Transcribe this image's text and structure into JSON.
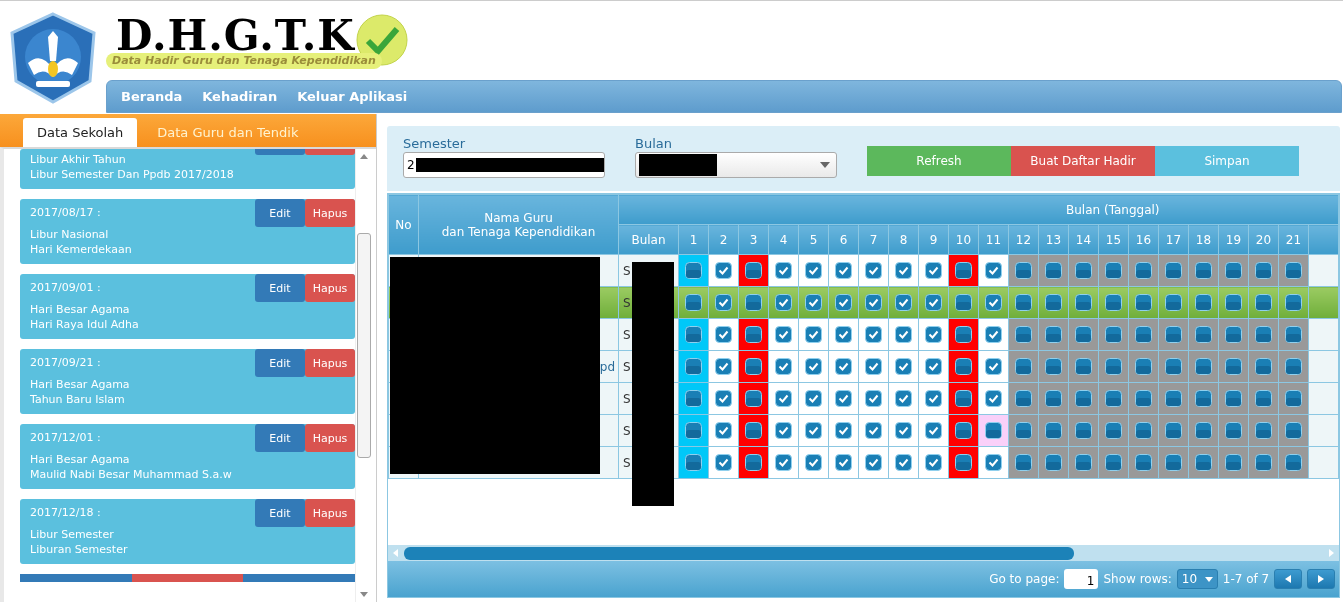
{
  "header": {
    "title": "D.H.G.T.K",
    "subtitle": "Data Hadir Guru dan Tenaga Kependidikan"
  },
  "nav": [
    {
      "label": "Beranda"
    },
    {
      "label": "Kehadiran"
    },
    {
      "label": "Keluar Aplikasi"
    }
  ],
  "left_tabs": [
    {
      "label": "Data Sekolah",
      "selected": true
    },
    {
      "label": "Data Guru dan Tendik",
      "selected": false
    }
  ],
  "holidays": [
    {
      "kind": "partial",
      "type": "Libur Akhir Tahun",
      "name": "Libur Semester Dan Ppdb 2017/2018"
    },
    {
      "kind": "full",
      "date": "2017/08/17 :",
      "type": "Libur Nasional",
      "name": "Hari Kemerdekaan",
      "edit": "Edit",
      "delete": "Hapus"
    },
    {
      "kind": "full",
      "date": "2017/09/01 :",
      "type": "Hari Besar Agama",
      "name": "Hari Raya Idul Adha",
      "edit": "Edit",
      "delete": "Hapus"
    },
    {
      "kind": "full",
      "date": "2017/09/21 :",
      "type": "Hari Besar Agama",
      "name": "Tahun Baru Islam",
      "edit": "Edit",
      "delete": "Hapus"
    },
    {
      "kind": "full",
      "date": "2017/12/01 :",
      "type": "Hari Besar Agama",
      "name": "Maulid Nabi Besar Muhammad S.a.w",
      "edit": "Edit",
      "delete": "Hapus"
    },
    {
      "kind": "full",
      "date": "2017/12/18 :",
      "type": "Libur Semester",
      "name": "Liburan Semester",
      "edit": "Edit",
      "delete": "Hapus"
    }
  ],
  "filters": {
    "semester": {
      "label": "Semester",
      "value": "2"
    },
    "bulan": {
      "label": "Bulan"
    }
  },
  "actions": [
    {
      "label": "Refresh",
      "kind": "success"
    },
    {
      "label": "Buat Daftar Hadir",
      "kind": "danger"
    },
    {
      "label": "Simpan",
      "kind": "info"
    }
  ],
  "table": {
    "columns": {
      "no": "No",
      "name": [
        "Nama Guru",
        "dan Tenaga Kependidikan"
      ],
      "group": "Bulan (Tanggal)",
      "bulan": "Bulan",
      "days": [
        "1",
        "2",
        "3",
        "4",
        "5",
        "6",
        "7",
        "8",
        "9",
        "10",
        "11",
        "12",
        "13",
        "14",
        "15",
        "16",
        "17",
        "18",
        "19",
        "20",
        "21"
      ]
    },
    "rows": [
      {
        "selected": false,
        "bulan": "S",
        "cells": [
          {
            "checked": false,
            "color": "#00c8f8"
          },
          {
            "checked": true,
            "color": "#ffffff"
          },
          {
            "checked": false,
            "color": "#ff0000"
          },
          {
            "checked": true,
            "color": "#ffffff"
          },
          {
            "checked": true,
            "color": "#ffffff"
          },
          {
            "checked": true,
            "color": "#ffffff"
          },
          {
            "checked": true,
            "color": "#ffffff"
          },
          {
            "checked": true,
            "color": "#ffffff"
          },
          {
            "checked": true,
            "color": "#ffffff"
          },
          {
            "checked": false,
            "color": "#ff0000"
          },
          {
            "checked": true,
            "color": "#ffffff"
          },
          {
            "checked": false,
            "color": "#999999"
          },
          {
            "checked": false,
            "color": "#999999"
          },
          {
            "checked": false,
            "color": "#999999"
          },
          {
            "checked": false,
            "color": "#999999"
          },
          {
            "checked": false,
            "color": "#999999"
          },
          {
            "checked": false,
            "color": "#999999"
          },
          {
            "checked": false,
            "color": "#999999"
          },
          {
            "checked": false,
            "color": "#999999"
          },
          {
            "checked": false,
            "color": "#999999"
          },
          {
            "checked": false,
            "color": "#999999"
          }
        ]
      },
      {
        "selected": true,
        "bulan": "S",
        "cells": [
          {
            "checked": false
          },
          {
            "checked": true
          },
          {
            "checked": false
          },
          {
            "checked": true
          },
          {
            "checked": true
          },
          {
            "checked": true
          },
          {
            "checked": true
          },
          {
            "checked": true
          },
          {
            "checked": true
          },
          {
            "checked": false
          },
          {
            "checked": true
          },
          {
            "checked": false
          },
          {
            "checked": false
          },
          {
            "checked": false
          },
          {
            "checked": false
          },
          {
            "checked": false
          },
          {
            "checked": false
          },
          {
            "checked": false
          },
          {
            "checked": false
          },
          {
            "checked": false
          },
          {
            "checked": false
          }
        ]
      },
      {
        "selected": false,
        "bulan": "S",
        "cells": [
          {
            "checked": false,
            "color": "#00c8f8"
          },
          {
            "checked": true,
            "color": "#ffffff"
          },
          {
            "checked": false,
            "color": "#ff0000"
          },
          {
            "checked": true,
            "color": "#ffffff"
          },
          {
            "checked": true,
            "color": "#ffffff"
          },
          {
            "checked": true,
            "color": "#ffffff"
          },
          {
            "checked": true,
            "color": "#ffffff"
          },
          {
            "checked": true,
            "color": "#ffffff"
          },
          {
            "checked": true,
            "color": "#ffffff"
          },
          {
            "checked": false,
            "color": "#ff0000"
          },
          {
            "checked": true,
            "color": "#ffffff"
          },
          {
            "checked": false,
            "color": "#999999"
          },
          {
            "checked": false,
            "color": "#999999"
          },
          {
            "checked": false,
            "color": "#999999"
          },
          {
            "checked": false,
            "color": "#999999"
          },
          {
            "checked": false,
            "color": "#999999"
          },
          {
            "checked": false,
            "color": "#999999"
          },
          {
            "checked": false,
            "color": "#999999"
          },
          {
            "checked": false,
            "color": "#999999"
          },
          {
            "checked": false,
            "color": "#999999"
          },
          {
            "checked": false,
            "color": "#999999"
          }
        ]
      },
      {
        "selected": false,
        "name": "pd",
        "bulan": "S",
        "cells": [
          {
            "checked": false,
            "color": "#00c8f8"
          },
          {
            "checked": true,
            "color": "#ffffff"
          },
          {
            "checked": false,
            "color": "#ff0000"
          },
          {
            "checked": true,
            "color": "#ffffff"
          },
          {
            "checked": true,
            "color": "#ffffff"
          },
          {
            "checked": true,
            "color": "#ffffff"
          },
          {
            "checked": true,
            "color": "#ffffff"
          },
          {
            "checked": true,
            "color": "#ffffff"
          },
          {
            "checked": true,
            "color": "#ffffff"
          },
          {
            "checked": false,
            "color": "#ff0000"
          },
          {
            "checked": true,
            "color": "#ffffff"
          },
          {
            "checked": false,
            "color": "#999999"
          },
          {
            "checked": false,
            "color": "#999999"
          },
          {
            "checked": false,
            "color": "#999999"
          },
          {
            "checked": false,
            "color": "#999999"
          },
          {
            "checked": false,
            "color": "#999999"
          },
          {
            "checked": false,
            "color": "#999999"
          },
          {
            "checked": false,
            "color": "#999999"
          },
          {
            "checked": false,
            "color": "#999999"
          },
          {
            "checked": false,
            "color": "#999999"
          },
          {
            "checked": false,
            "color": "#999999"
          }
        ]
      },
      {
        "selected": false,
        "bulan": "S",
        "cells": [
          {
            "checked": false,
            "color": "#00c8f8"
          },
          {
            "checked": true,
            "color": "#ffffff"
          },
          {
            "checked": false,
            "color": "#ff0000"
          },
          {
            "checked": true,
            "color": "#ffffff"
          },
          {
            "checked": true,
            "color": "#ffffff"
          },
          {
            "checked": true,
            "color": "#ffffff"
          },
          {
            "checked": true,
            "color": "#ffffff"
          },
          {
            "checked": true,
            "color": "#ffffff"
          },
          {
            "checked": true,
            "color": "#ffffff"
          },
          {
            "checked": false,
            "color": "#ff0000"
          },
          {
            "checked": true,
            "color": "#ffffff"
          },
          {
            "checked": false,
            "color": "#999999"
          },
          {
            "checked": false,
            "color": "#999999"
          },
          {
            "checked": false,
            "color": "#999999"
          },
          {
            "checked": false,
            "color": "#999999"
          },
          {
            "checked": false,
            "color": "#999999"
          },
          {
            "checked": false,
            "color": "#999999"
          },
          {
            "checked": false,
            "color": "#999999"
          },
          {
            "checked": false,
            "color": "#999999"
          },
          {
            "checked": false,
            "color": "#999999"
          },
          {
            "checked": false,
            "color": "#999999"
          }
        ]
      },
      {
        "selected": false,
        "bulan": "S",
        "cells": [
          {
            "checked": false,
            "color": "#00c8f8"
          },
          {
            "checked": true,
            "color": "#ffffff"
          },
          {
            "checked": false,
            "color": "#ff0000"
          },
          {
            "checked": true,
            "color": "#ffffff"
          },
          {
            "checked": true,
            "color": "#ffffff"
          },
          {
            "checked": true,
            "color": "#ffffff"
          },
          {
            "checked": true,
            "color": "#ffffff"
          },
          {
            "checked": true,
            "color": "#ffffff"
          },
          {
            "checked": true,
            "color": "#ffffff"
          },
          {
            "checked": false,
            "color": "#ff0000"
          },
          {
            "checked": false,
            "color": "#f9d0f9"
          },
          {
            "checked": false,
            "color": "#999999"
          },
          {
            "checked": false,
            "color": "#999999"
          },
          {
            "checked": false,
            "color": "#999999"
          },
          {
            "checked": false,
            "color": "#999999"
          },
          {
            "checked": false,
            "color": "#999999"
          },
          {
            "checked": false,
            "color": "#999999"
          },
          {
            "checked": false,
            "color": "#999999"
          },
          {
            "checked": false,
            "color": "#999999"
          },
          {
            "checked": false,
            "color": "#999999"
          },
          {
            "checked": false,
            "color": "#999999"
          }
        ]
      },
      {
        "selected": false,
        "bulan": "S",
        "cells": [
          {
            "checked": false,
            "color": "#00c8f8"
          },
          {
            "checked": true,
            "color": "#ffffff"
          },
          {
            "checked": false,
            "color": "#ff0000"
          },
          {
            "checked": true,
            "color": "#ffffff"
          },
          {
            "checked": true,
            "color": "#ffffff"
          },
          {
            "checked": true,
            "color": "#ffffff"
          },
          {
            "checked": true,
            "color": "#ffffff"
          },
          {
            "checked": true,
            "color": "#ffffff"
          },
          {
            "checked": true,
            "color": "#ffffff"
          },
          {
            "checked": false,
            "color": "#ff0000"
          },
          {
            "checked": true,
            "color": "#ffffff"
          },
          {
            "checked": false,
            "color": "#999999"
          },
          {
            "checked": false,
            "color": "#999999"
          },
          {
            "checked": false,
            "color": "#999999"
          },
          {
            "checked": false,
            "color": "#999999"
          },
          {
            "checked": false,
            "color": "#999999"
          },
          {
            "checked": false,
            "color": "#999999"
          },
          {
            "checked": false,
            "color": "#999999"
          },
          {
            "checked": false,
            "color": "#999999"
          },
          {
            "checked": false,
            "color": "#999999"
          },
          {
            "checked": false,
            "color": "#999999"
          }
        ]
      }
    ]
  },
  "pagination": {
    "go_to_label": "Go to page:",
    "page": "1",
    "rows_label": "Show rows:",
    "rows": "10",
    "range": "1-7 of 7"
  }
}
